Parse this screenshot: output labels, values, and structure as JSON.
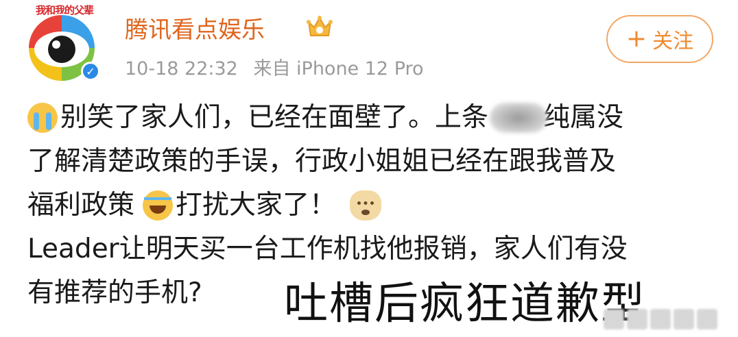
{
  "header": {
    "avatar_caption": "我和我的父辈",
    "username": "腾讯看点娱乐",
    "timestamp": "10-18 22:32",
    "source": "来自 iPhone 12 Pro",
    "follow_plus": "+",
    "follow_label": "关注"
  },
  "post": {
    "line1_text": "别笑了家人们，已经在面壁了。上条",
    "line1_end": "纯属没",
    "line2": "了解清楚政策的手误，行政小姐姐已经在跟我普及",
    "line3_a": "福利政策",
    "line3_b": "打扰大家了！",
    "line4": "Leader让明天买一台工作机找他报销，家人们有没",
    "line5": "有推荐的手机?"
  },
  "overlay": {
    "caption": "吐槽后疯狂道歉型"
  },
  "colors": {
    "username": "#e0651c",
    "follow_border": "#f4a765",
    "meta": "#9a9a9a",
    "verified": "#2a8ae6"
  },
  "icons": {
    "avatar": "eye-logo-icon",
    "verified": "verified-badge-icon",
    "crown": "crown-icon",
    "emoji1": "crying-face-emoji-icon",
    "emoji2": "laughing-tears-emoji-icon",
    "emoji3": "shiba-dog-emoji-icon"
  }
}
